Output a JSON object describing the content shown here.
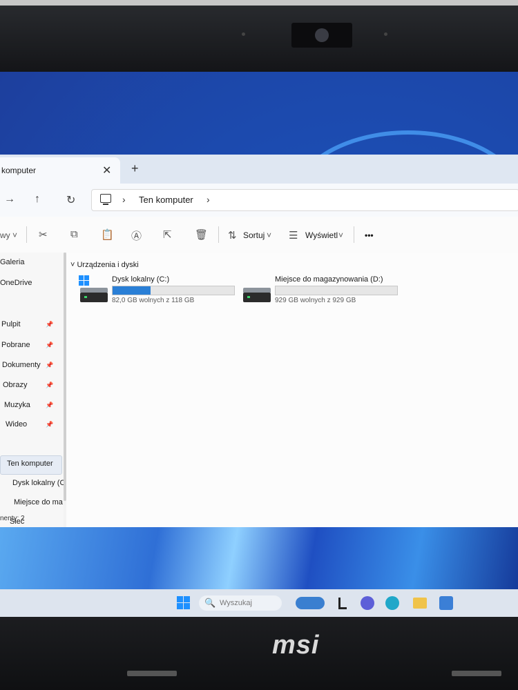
{
  "tab": {
    "title": "komputer",
    "close": "✕",
    "new": "+"
  },
  "nav": {
    "back": "→",
    "up": "↑",
    "refresh": "↻",
    "sep": "›",
    "crumb": "Ten komputer"
  },
  "toolbar": {
    "new_label": "wy ˅",
    "sort_label": "Sortuj",
    "view_label": "Wyświetl",
    "chevron": "˅",
    "more": "•••"
  },
  "sidebar": {
    "items": [
      {
        "label": "Galeria"
      },
      {
        "label": "OneDrive"
      },
      {
        "label": "Pulpit",
        "pin": "📌"
      },
      {
        "label": "Pobrane",
        "pin": "📌"
      },
      {
        "label": "Dokumenty",
        "pin": "📌"
      },
      {
        "label": "Obrazy",
        "pin": "📌"
      },
      {
        "label": "Muzyka",
        "pin": "📌"
      },
      {
        "label": "Wideo",
        "pin": "📌"
      },
      {
        "label": "Ten komputer"
      },
      {
        "label": "Dysk lokalny (C"
      },
      {
        "label": "Miejsce do ma"
      },
      {
        "label": "Sieć"
      }
    ]
  },
  "status": {
    "text": "nenty: 2"
  },
  "content": {
    "group_title": "Urządzenia i dyski",
    "drives": [
      {
        "name": "Dysk lokalny (C:)",
        "free_text": "82,0 GB wolnych z 118 GB",
        "used_fraction": 0.31
      },
      {
        "name": "Miejsce do magazynowania (D:)",
        "free_text": "929 GB wolnych z 929 GB",
        "used_fraction": 0.0
      }
    ]
  },
  "taskbar": {
    "search_placeholder": "Wyszukaj",
    "search_icon": "🔍"
  },
  "bezel": {
    "brand": "msi"
  },
  "colors": {
    "accent": "#2a7fd6",
    "desktop": "#1d4fb4"
  }
}
